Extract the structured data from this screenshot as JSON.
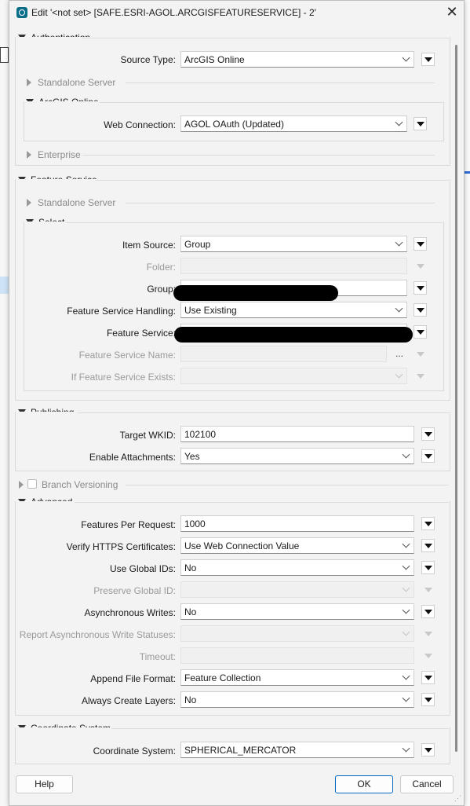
{
  "window": {
    "title": "Edit '<not set> [SAFE.ESRI-AGOL.ARCGISFEATURESERVICE] - 2'"
  },
  "authentication": {
    "header": "Authentication",
    "source_type": {
      "label": "Source Type:",
      "value": "ArcGIS Online"
    },
    "standalone_server": "Standalone Server",
    "arcgis_online": {
      "header": "ArcGIS Online",
      "web_connection": {
        "label": "Web Connection:",
        "value": "AGOL OAuth (Updated)"
      }
    },
    "enterprise": "Enterprise"
  },
  "feature_service": {
    "header": "Feature Service",
    "standalone_server": "Standalone Server",
    "select": {
      "header": "Select",
      "item_source": {
        "label": "Item Source:",
        "value": "Group"
      },
      "folder": {
        "label": "Folder:",
        "value": ""
      },
      "group": {
        "label": "Group:",
        "value": ""
      },
      "handling": {
        "label": "Feature Service Handling:",
        "value": "Use Existing"
      },
      "service": {
        "label": "Feature Service:",
        "value": ""
      },
      "service_name": {
        "label": "Feature Service Name:",
        "value": "",
        "browse": "..."
      },
      "if_exists": {
        "label": "If Feature Service Exists:",
        "value": ""
      }
    }
  },
  "publishing": {
    "header": "Publishing",
    "target_wkid": {
      "label": "Target WKID:",
      "value": "102100"
    },
    "enable_attachments": {
      "label": "Enable Attachments:",
      "value": "Yes"
    }
  },
  "branch_versioning": {
    "label": "Branch Versioning",
    "checked": false
  },
  "advanced": {
    "header": "Advanced",
    "features_per_request": {
      "label": "Features Per Request:",
      "value": "1000"
    },
    "verify_https": {
      "label": "Verify HTTPS Certificates:",
      "value": "Use Web Connection Value"
    },
    "use_global_ids": {
      "label": "Use Global IDs:",
      "value": "No"
    },
    "preserve_global_id": {
      "label": "Preserve Global ID:",
      "value": ""
    },
    "async_writes": {
      "label": "Asynchronous Writes:",
      "value": "No"
    },
    "report_async": {
      "label": "Report Asynchronous Write Statuses:",
      "value": ""
    },
    "timeout": {
      "label": "Timeout:",
      "value": ""
    },
    "append_format": {
      "label": "Append File Format:",
      "value": "Feature Collection"
    },
    "always_create_layers": {
      "label": "Always Create Layers:",
      "value": "No"
    }
  },
  "coordinate_system": {
    "header": "Coordinate System",
    "cs": {
      "label": "Coordinate System:",
      "value": "SPHERICAL_MERCATOR"
    }
  },
  "buttons": {
    "help": "Help",
    "ok": "OK",
    "cancel": "Cancel"
  },
  "colors": {
    "accent": "#0067c0",
    "title_icon": "#0a6e8a"
  }
}
